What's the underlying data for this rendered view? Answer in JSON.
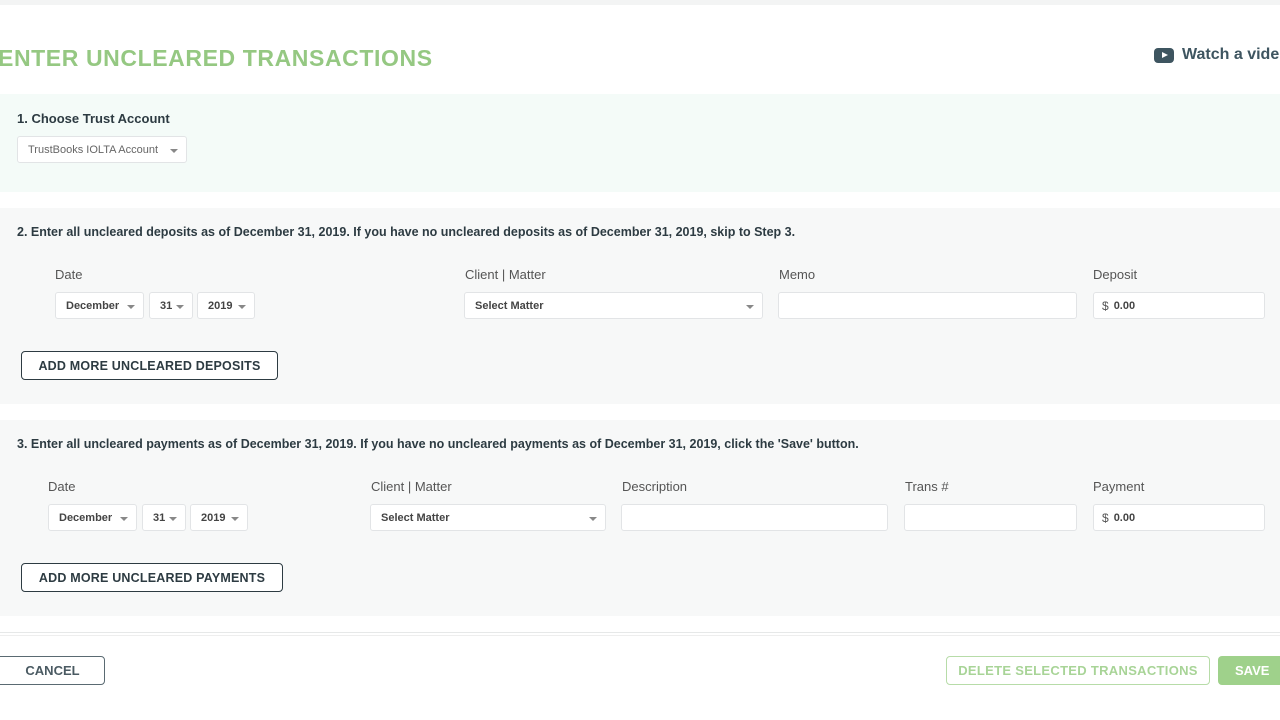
{
  "page": {
    "title": "ENTER UNCLEARED TRANSACTIONS",
    "watch_video": "Watch a vide"
  },
  "step1": {
    "heading": "1. Choose Trust Account",
    "account_selected": "TrustBooks IOLTA Account"
  },
  "step2": {
    "heading": "2. Enter all uncleared deposits as of December 31, 2019. If you have no uncleared deposits as of December 31, 2019, skip to Step 3.",
    "columns": {
      "date": "Date",
      "client_matter": "Client | Matter",
      "memo": "Memo",
      "deposit": "Deposit"
    },
    "row": {
      "month": "December",
      "day": "31",
      "year": "2019",
      "matter_placeholder": "Select Matter",
      "currency": "$",
      "amount": "0.00"
    },
    "add_button": "ADD MORE UNCLEARED DEPOSITS"
  },
  "step3": {
    "heading": "3. Enter all uncleared payments as of December 31, 2019. If you have no uncleared payments as of December 31, 2019, click the 'Save' button.",
    "columns": {
      "date": "Date",
      "client_matter": "Client | Matter",
      "description": "Description",
      "trans_no": "Trans #",
      "payment": "Payment"
    },
    "row": {
      "month": "December",
      "day": "31",
      "year": "2019",
      "matter_placeholder": "Select Matter",
      "currency": "$",
      "amount": "0.00"
    },
    "add_button": "ADD MORE UNCLEARED PAYMENTS"
  },
  "footer": {
    "cancel": "CANCEL",
    "delete": "DELETE SELECTED TRANSACTIONS",
    "save": "SAVE"
  },
  "colors": {
    "accent_green": "#95c882",
    "dark_text": "#2d3b42"
  },
  "icons": {
    "watch_video": "youtube-play-icon",
    "dropdown": "caret-down-icon"
  }
}
